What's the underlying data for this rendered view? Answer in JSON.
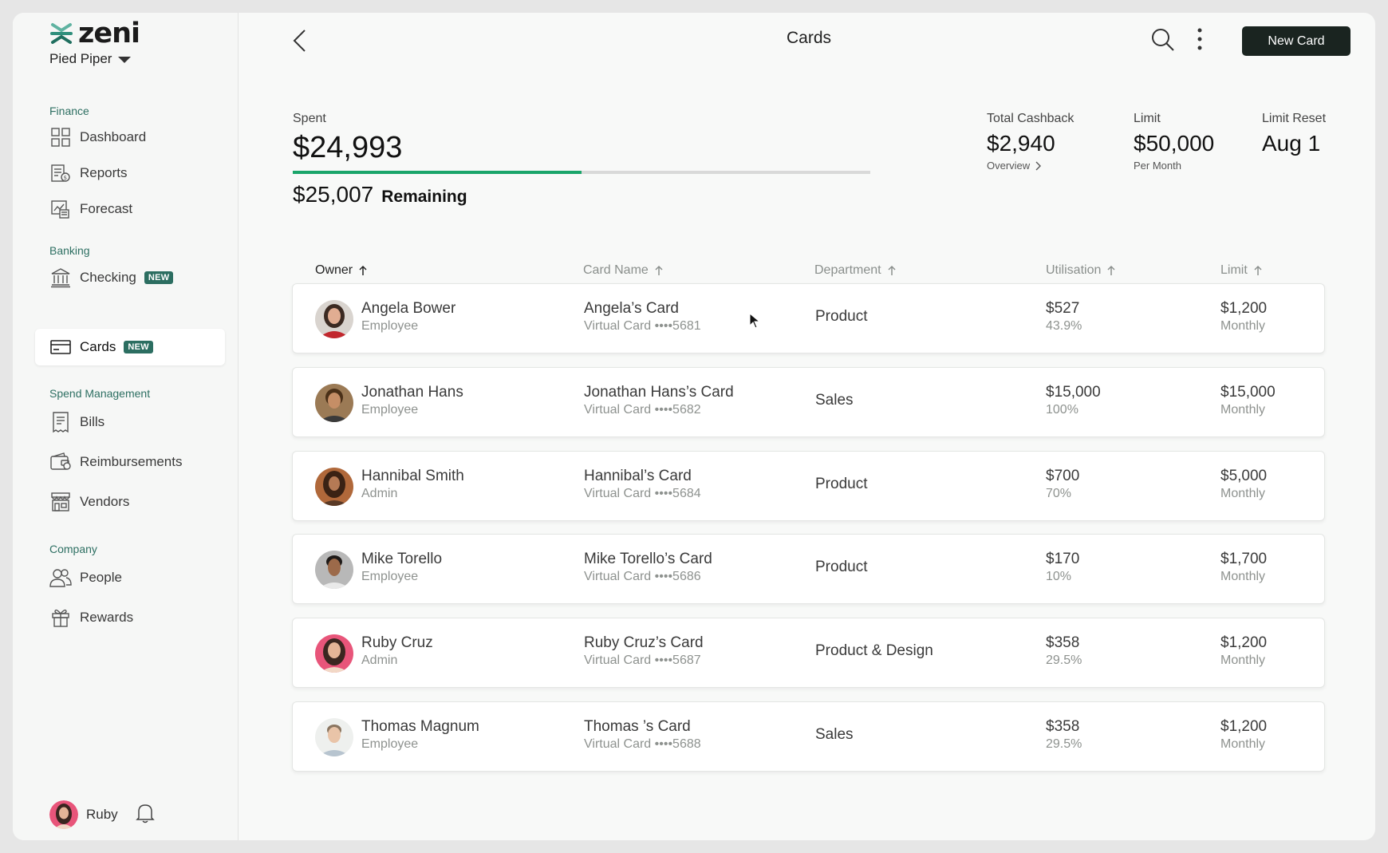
{
  "app": {
    "logo_text": "zeni",
    "org": "Pied Piper",
    "brand_color": "#1f6f5f",
    "accent_green": "#1aa56a"
  },
  "sidebar": {
    "sections": [
      {
        "title": "Finance",
        "items": [
          {
            "label": "Dashboard",
            "icon": "dashboard-icon"
          },
          {
            "label": "Reports",
            "icon": "reports-icon"
          },
          {
            "label": "Forecast",
            "icon": "forecast-icon"
          }
        ]
      },
      {
        "title": "Banking",
        "items": [
          {
            "label": "Checking",
            "icon": "bank-icon",
            "badge": "NEW"
          },
          {
            "label": "Cards",
            "icon": "card-icon",
            "badge": "NEW",
            "active": true
          }
        ]
      },
      {
        "title": "Spend Management",
        "items": [
          {
            "label": "Bills",
            "icon": "bills-icon"
          },
          {
            "label": "Reimbursements",
            "icon": "wallet-icon"
          },
          {
            "label": "Vendors",
            "icon": "store-icon"
          }
        ]
      },
      {
        "title": "Company",
        "items": [
          {
            "label": "People",
            "icon": "people-icon"
          },
          {
            "label": "Rewards",
            "icon": "gift-icon"
          }
        ]
      }
    ],
    "user": {
      "name": "Ruby"
    }
  },
  "header": {
    "title": "Cards",
    "new_card_label": "New Card"
  },
  "summary": {
    "spent_label": "Spent",
    "spent_amount": "$24,993",
    "spent_fraction": 0.4999,
    "remaining_amount": "$25,007",
    "remaining_label": "Remaining",
    "cashback_label": "Total Cashback",
    "cashback_value": "$2,940",
    "cashback_link": "Overview",
    "limit_label": "Limit",
    "limit_value": "$50,000",
    "limit_sub": "Per Month",
    "reset_label": "Limit Reset",
    "reset_value": "Aug 1"
  },
  "table": {
    "columns": [
      "Owner",
      "Card Name",
      "Department",
      "Utilisation",
      "Limit"
    ],
    "rows": [
      {
        "owner": "Angela Bower",
        "role": "Employee",
        "card": "Angela’s Card",
        "card_sub": "Virtual Card ••••5681",
        "dept": "Product",
        "util": "$527",
        "util_pct": "43.9%",
        "limit": "$1,200",
        "period": "Monthly"
      },
      {
        "owner": "Jonathan Hans",
        "role": "Employee",
        "card": "Jonathan Hans’s Card",
        "card_sub": "Virtual Card ••••5682",
        "dept": "Sales",
        "util": "$15,000",
        "util_pct": "100%",
        "limit": "$15,000",
        "period": "Monthly"
      },
      {
        "owner": "Hannibal Smith",
        "role": "Admin",
        "card": "Hannibal’s Card",
        "card_sub": "Virtual Card ••••5684",
        "dept": "Product",
        "util": "$700",
        "util_pct": "70%",
        "limit": "$5,000",
        "period": "Monthly"
      },
      {
        "owner": "Mike Torello",
        "role": "Employee",
        "card": "Mike Torello’s Card",
        "card_sub": "Virtual Card ••••5686",
        "dept": "Product",
        "util": "$170",
        "util_pct": "10%",
        "limit": "$1,700",
        "period": "Monthly"
      },
      {
        "owner": "Ruby Cruz",
        "role": "Admin",
        "card": "Ruby Cruz’s Card",
        "card_sub": "Virtual Card ••••5687",
        "dept": "Product & Design",
        "util": "$358",
        "util_pct": "29.5%",
        "limit": "$1,200",
        "period": "Monthly"
      },
      {
        "owner": "Thomas Magnum",
        "role": "Employee",
        "card": "Thomas ’s Card",
        "card_sub": "Virtual Card ••••5688",
        "dept": "Sales",
        "util": "$358",
        "util_pct": "29.5%",
        "limit": "$1,200",
        "period": "Monthly"
      }
    ]
  }
}
